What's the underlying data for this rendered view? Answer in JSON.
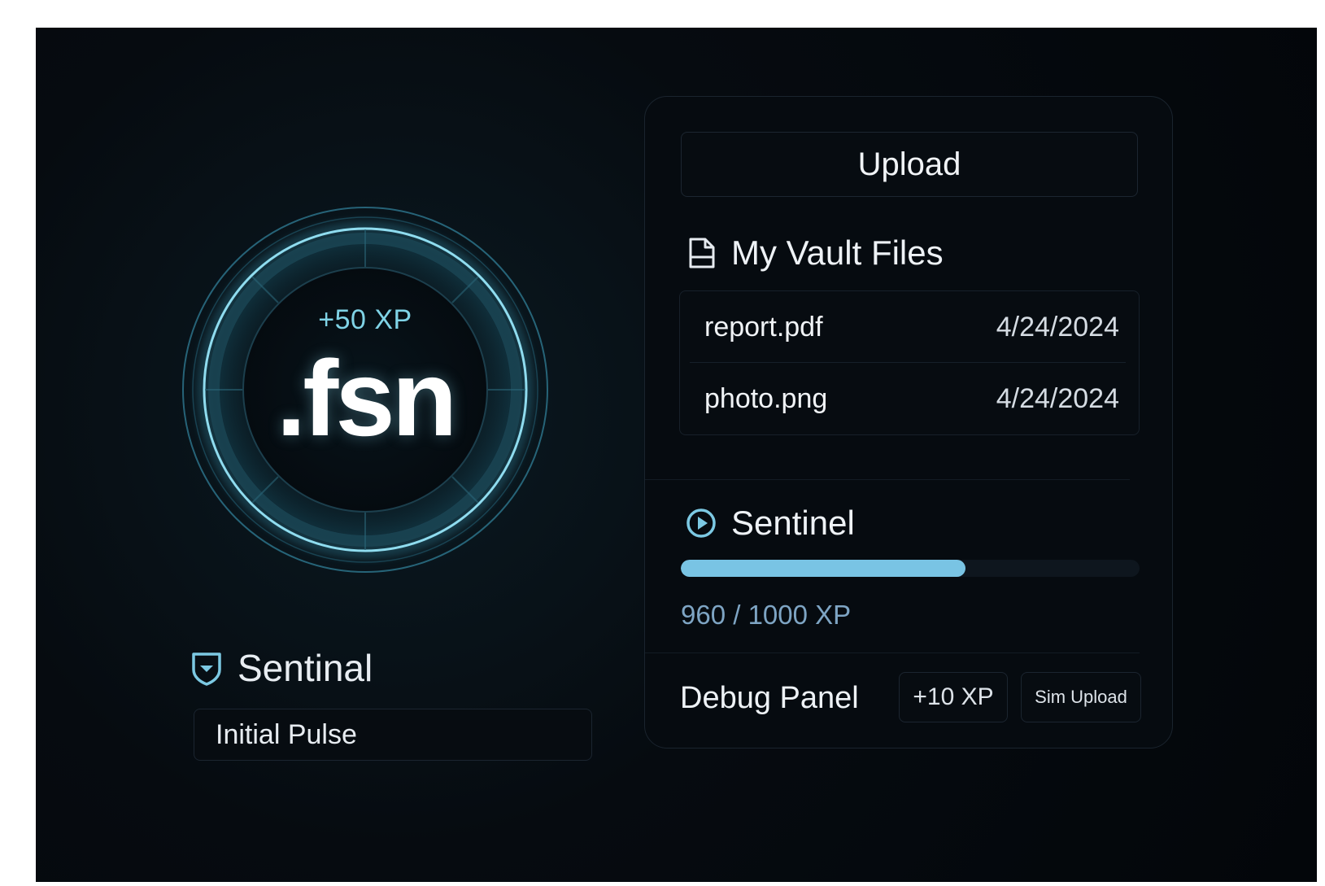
{
  "orb": {
    "xp_gain": "+50 XP",
    "name": ".fsn"
  },
  "rank": {
    "icon": "shield-icon",
    "title": "Sentinal",
    "status": "Initial Pulse"
  },
  "vault": {
    "upload_label": "Upload",
    "files_icon": "document-icon",
    "files_title": "My Vault Files",
    "files": [
      {
        "name": "report.pdf",
        "date": "4/24/2024"
      },
      {
        "name": "photo.png",
        "date": "4/24/2024"
      }
    ]
  },
  "level": {
    "icon": "play-circle-icon",
    "title": "Sentinel",
    "xp_current": 960,
    "xp_max": 1000,
    "progress_fraction": 0.62,
    "xp_text": "960 / 1000 XP"
  },
  "debug": {
    "title": "Debug Panel",
    "add_xp_label": "+10 XP",
    "sim_upload_label": "Sim Upload"
  },
  "colors": {
    "accent": "#79c4e4",
    "ring": "#6ec9e2",
    "background": "#03060a"
  }
}
